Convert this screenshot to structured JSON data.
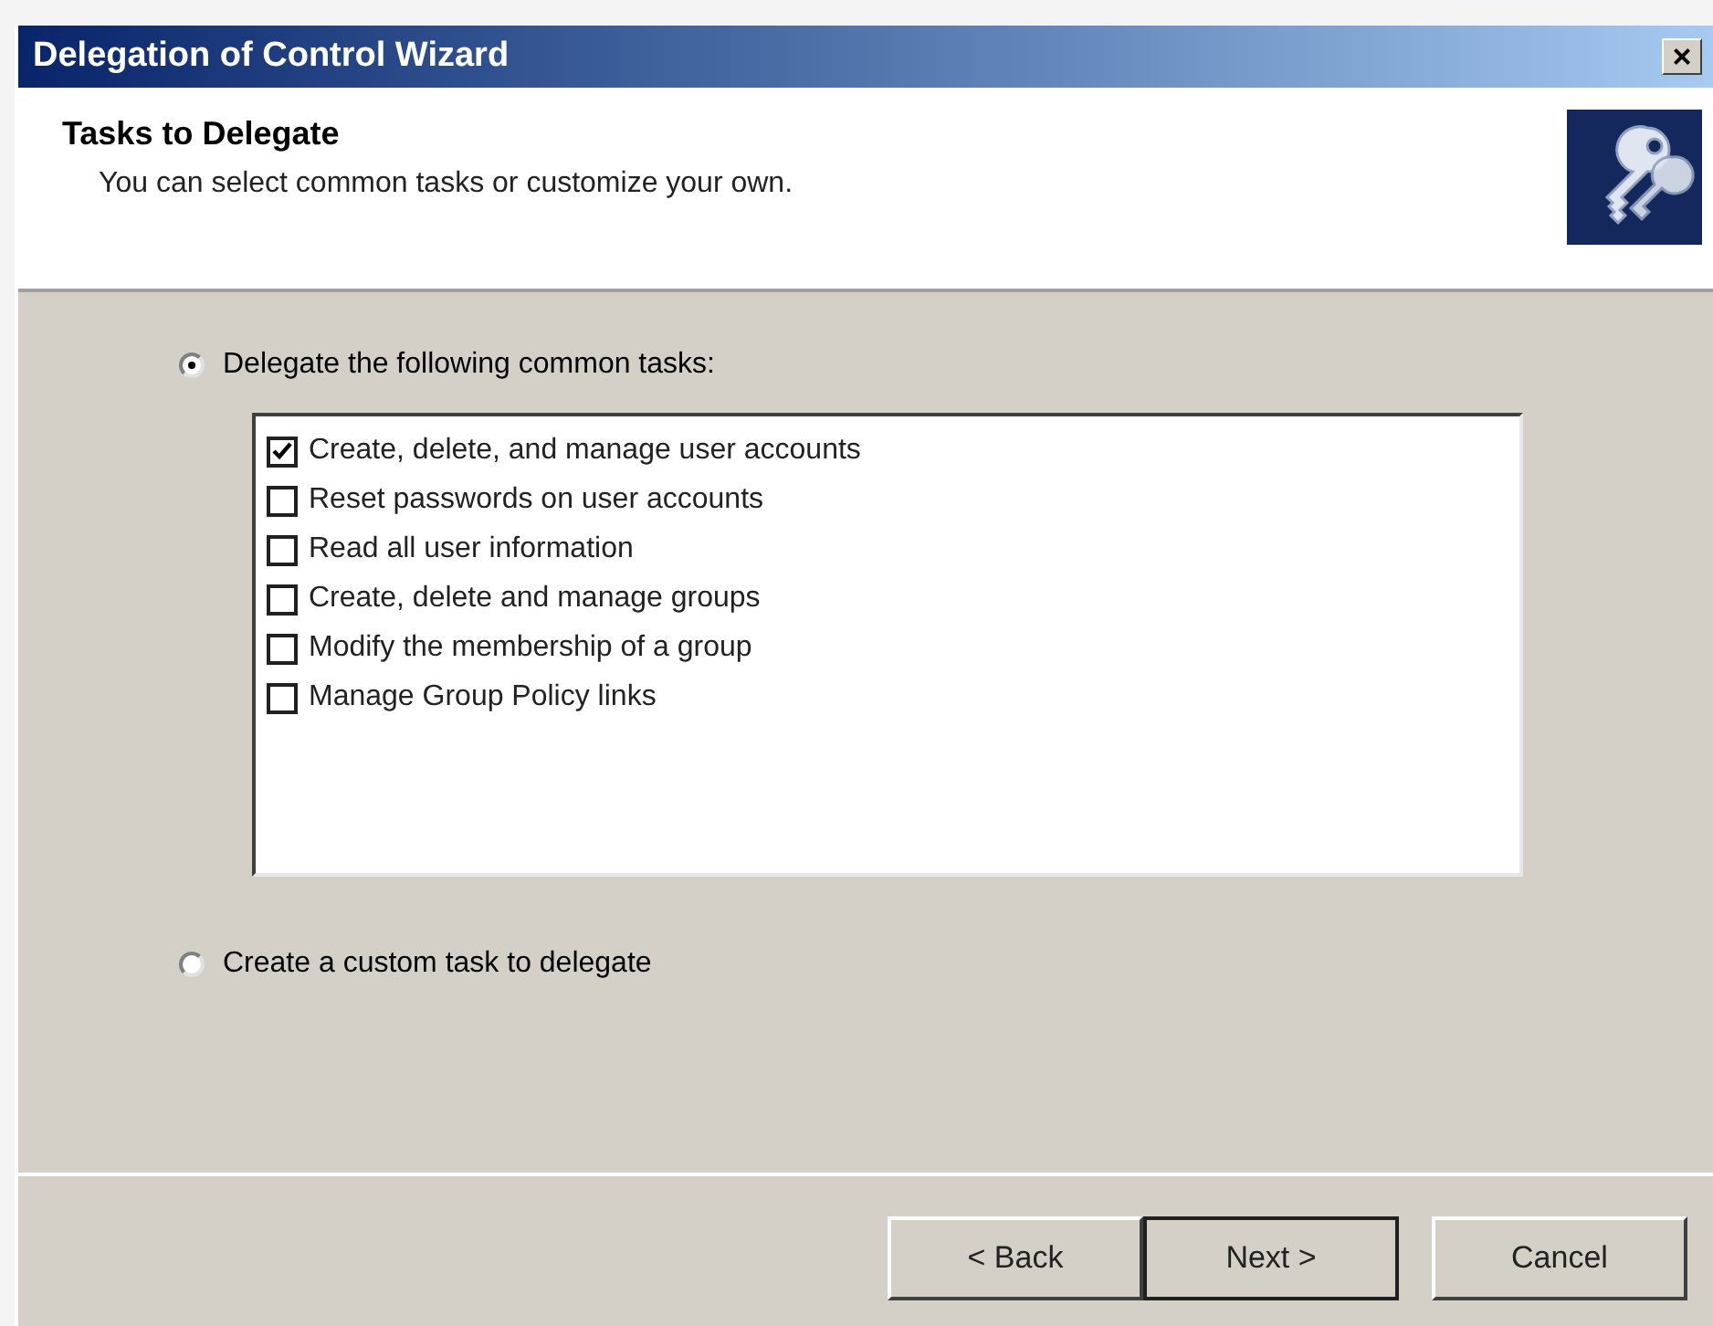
{
  "window": {
    "title": "Delegation of Control Wizard",
    "close": "×"
  },
  "header": {
    "title": "Tasks to Delegate",
    "subtitle": "You can select common tasks or customize your own."
  },
  "options": [
    {
      "label": "Delegate the following common tasks:",
      "selected": true,
      "tasks": [
        {
          "label": "Create, delete, and manage user accounts",
          "checked": true
        },
        {
          "label": "Reset passwords on user accounts",
          "checked": false
        },
        {
          "label": "Read all user information",
          "checked": false
        },
        {
          "label": "Create, delete and manage groups",
          "checked": false
        },
        {
          "label": "Modify the membership of a group",
          "checked": false
        },
        {
          "label": "Manage Group Policy links",
          "checked": false
        }
      ]
    },
    {
      "label": "Create a custom task to delegate",
      "selected": false
    }
  ],
  "buttons": [
    {
      "label": "< Back",
      "default": false
    },
    {
      "label": "Next >",
      "default": true
    },
    {
      "label": "Cancel",
      "default": false
    }
  ]
}
